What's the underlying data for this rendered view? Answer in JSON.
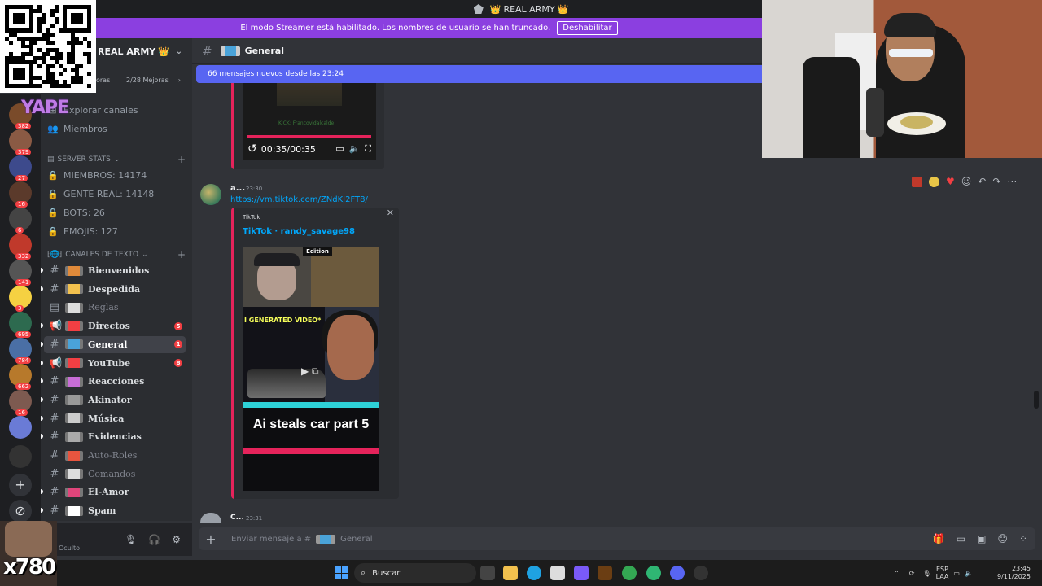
{
  "window": {
    "title": "REAL ARMY",
    "title_prefix_icon": "discord-gem-icon",
    "title_crowns": "👑"
  },
  "streamer_banner": {
    "text": "El modo Streamer está habilitado. Los nombres de usuario se han truncado.",
    "button": "Deshabilitar"
  },
  "server": {
    "name": "REAL ARMY",
    "crown": "👑",
    "boost_left": "oras",
    "boost_right": "2/28 Mejoras"
  },
  "nav": {
    "browse": "Explorar canales",
    "members": "Miembros"
  },
  "stats": {
    "category": "SERVER STATS",
    "items": [
      "MIEMBROS: 14174",
      "GENTE REAL: 14148",
      "BOTS: 26",
      "EMOJIS: 127"
    ]
  },
  "text_category": "CANALES DE TEXTO",
  "channels": [
    {
      "name": "Bienvenidos",
      "muted": false,
      "badge": ""
    },
    {
      "name": "Despedida",
      "muted": false,
      "badge": ""
    },
    {
      "name": "Reglas",
      "muted": true,
      "badge": ""
    },
    {
      "name": "Directos",
      "muted": false,
      "badge": "5"
    },
    {
      "name": "General",
      "muted": false,
      "badge": "1",
      "selected": true
    },
    {
      "name": "YouTube",
      "muted": false,
      "badge": "8"
    },
    {
      "name": "Reacciones",
      "muted": false,
      "badge": ""
    },
    {
      "name": "Akinator",
      "muted": false,
      "badge": ""
    },
    {
      "name": "Música",
      "muted": false,
      "badge": ""
    },
    {
      "name": "Evidencias",
      "muted": false,
      "badge": ""
    },
    {
      "name": "Auto-Roles",
      "muted": true,
      "badge": ""
    },
    {
      "name": "Comandos",
      "muted": true,
      "badge": ""
    },
    {
      "name": "El-Amor",
      "muted": false,
      "badge": ""
    },
    {
      "name": "Spam",
      "muted": false,
      "badge": ""
    }
  ],
  "server_badges": [
    "382",
    "379",
    "27",
    "16",
    "6",
    "332",
    "141",
    "3",
    "695",
    "784",
    "662",
    "16"
  ],
  "chat": {
    "channel_name": "General",
    "new_messages": "66 mensajes nuevos desde las 23:24",
    "video": {
      "time": "00:35/00:35",
      "credit": "KICK: Francovidalcalde"
    },
    "message": {
      "author": "a...",
      "time": "23:30",
      "link": "https://vm.tiktok.com/ZNdKJ2FT8/",
      "embed": {
        "provider": "TikTok",
        "title": "TikTok · randy_savage98",
        "tag": "Edition",
        "overlay_text": "I GENERATED VIDEO*",
        "caption": "Ai steals car part 5"
      }
    },
    "next_message": {
      "author": "C...",
      "time": "23:31"
    },
    "composer_placeholder_prefix": "Enviar mensaje a #",
    "composer_channel": "General"
  },
  "user_panel": {
    "status": "Oculto"
  },
  "overlays": {
    "yape": "YAPE",
    "counter": "x780"
  },
  "taskbar": {
    "search": "Buscar",
    "lang_top": "ESP",
    "lang_bottom": "LAA",
    "time": "23:45",
    "date": "9/11/2025"
  },
  "colors": {
    "accent": "#5865f2",
    "streamer": "#8b3fe0",
    "embed_border": "#e5235b",
    "link": "#00a8fc"
  }
}
